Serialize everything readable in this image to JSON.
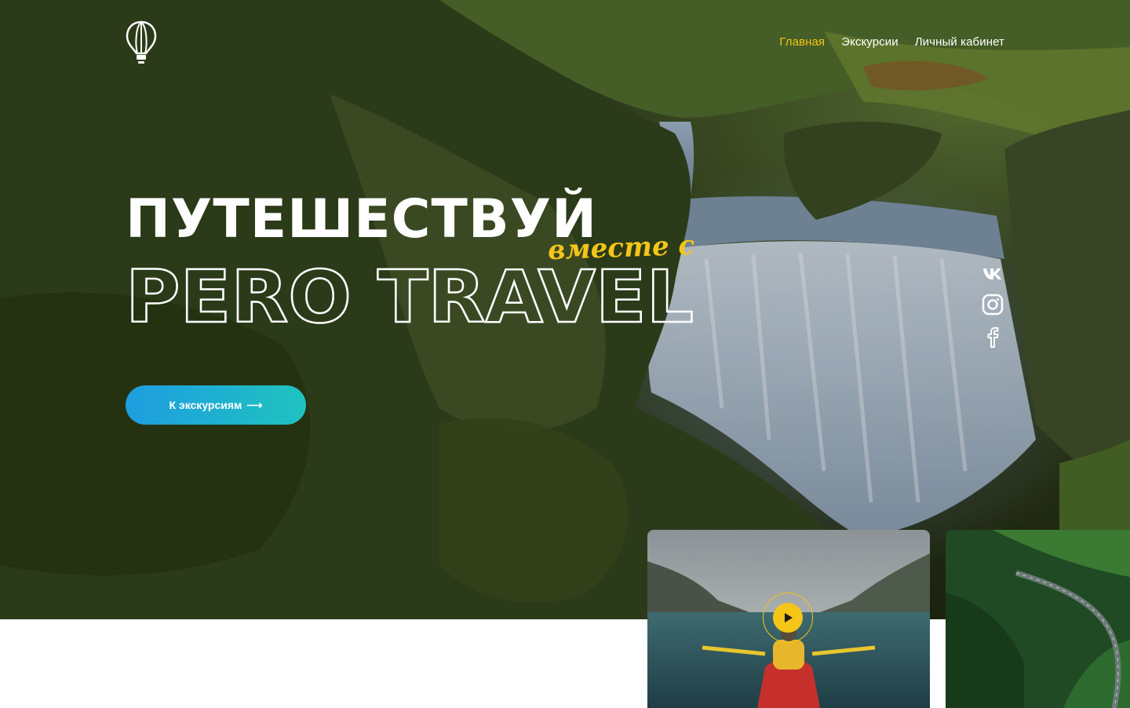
{
  "header": {
    "logo_icon": "hot-air-balloon-icon",
    "nav": [
      {
        "label": "Главная",
        "active": true
      },
      {
        "label": "Экскурсии",
        "active": false
      },
      {
        "label": "Личный кабинет",
        "active": false
      }
    ]
  },
  "hero": {
    "title_line1": "ПУТЕШЕСТВУЙ",
    "script_text": "вместе с",
    "title_line2": "PERO TRAVEL",
    "cta_label": "К экскурсиям",
    "cta_arrow": "⟶"
  },
  "social": [
    {
      "name": "vk-icon"
    },
    {
      "name": "instagram-icon"
    },
    {
      "name": "facebook-icon"
    }
  ],
  "cards": [
    {
      "name": "kayak-video-card",
      "icon": "play-icon"
    },
    {
      "name": "forest-road-card"
    }
  ],
  "colors": {
    "accent": "#f5c518",
    "cta_gradient_start": "#1e9de0",
    "cta_gradient_end": "#1fc3c0",
    "text": "#ffffff"
  }
}
